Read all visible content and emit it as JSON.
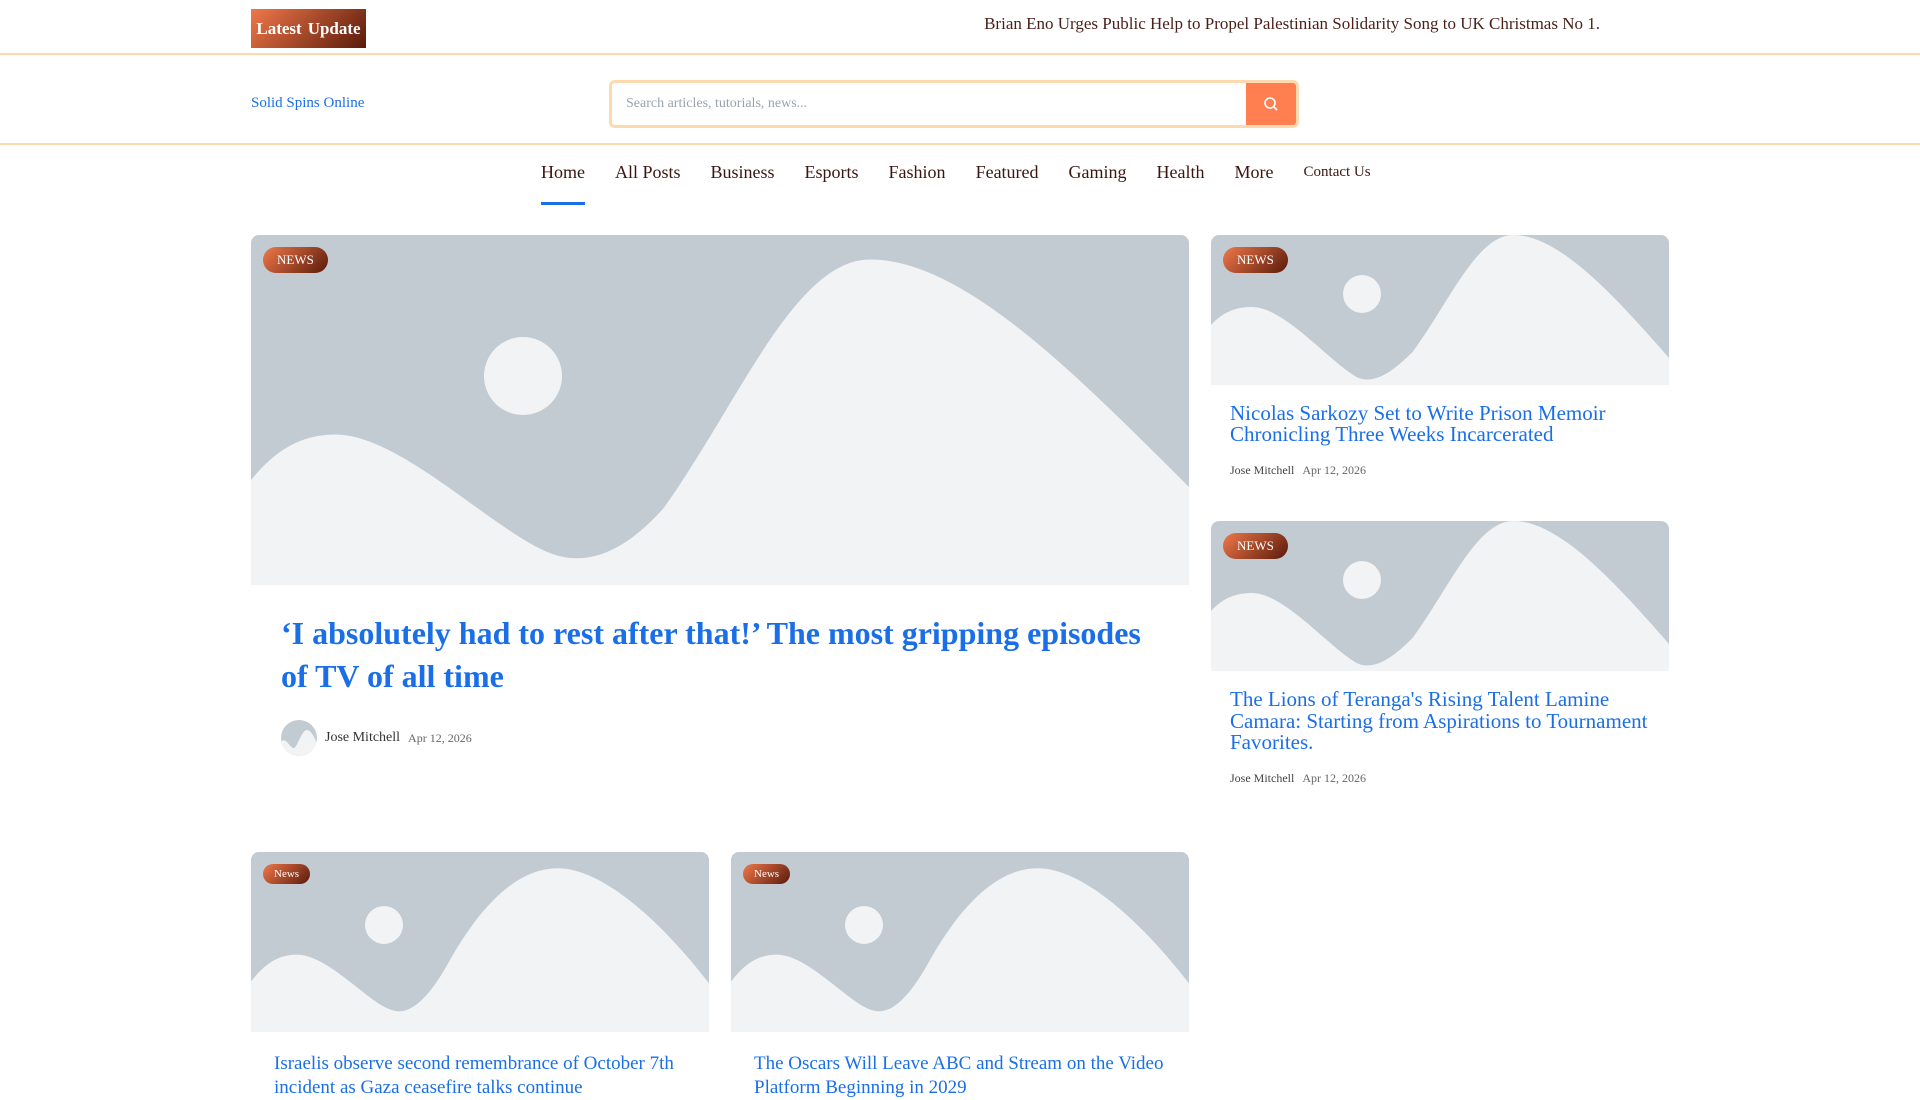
{
  "topbar": {
    "latest_label_1": "Latest",
    "latest_label_2": "Update",
    "ticker": "Brian Eno Urges Public Help to Propel Palestinian Solidarity Song to UK Christmas No 1."
  },
  "header": {
    "logo": "Solid Spins Online",
    "search_placeholder": "Search articles, tutorials, news...",
    "search_icon": "search-icon"
  },
  "nav": {
    "items": [
      "Home",
      "All Posts",
      "Business",
      "Esports",
      "Fashion",
      "Featured",
      "Gaming",
      "Health",
      "More",
      "Contact Us"
    ],
    "active": "Home"
  },
  "hero": {
    "badge": "NEWS",
    "title": "‘I absolutely had to rest after that!’ The most gripping episodes of TV of all time",
    "author": "Jose Mitchell",
    "date": "Apr 12, 2026"
  },
  "side": [
    {
      "badge": "NEWS",
      "title": "Nicolas Sarkozy Set to Write Prison Memoir Chronicling Three Weeks Incarcerated",
      "author": "Jose Mitchell",
      "date": "Apr 12, 2026"
    },
    {
      "badge": "NEWS",
      "title": "The Lions of Teranga's Rising Talent Lamine Camara: Starting from Aspirations to Tournament Favorites.",
      "author": "Jose Mitchell",
      "date": "Apr 12, 2026"
    }
  ],
  "bottom": [
    {
      "badge": "News",
      "title": "Israelis observe second remembrance of October 7th incident as Gaza ceasefire talks continue"
    },
    {
      "badge": "News",
      "title": "The Oscars Will Leave ABC and Stream on the Video Platform Beginning in 2029"
    }
  ],
  "colors": {
    "accent": "#1a6fe8",
    "brand": "#ff7f50",
    "border": "#fdd9b0"
  }
}
